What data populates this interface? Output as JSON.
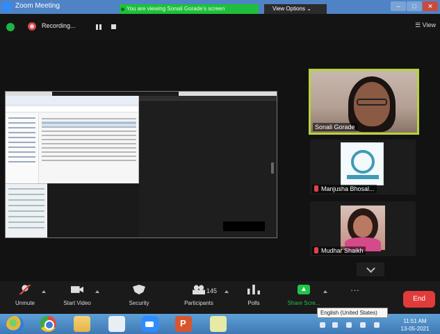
{
  "window": {
    "title": "Zoom Meeting",
    "viewing_banner": "You are viewing Sonali Gorade's screen",
    "view_options": "View Options"
  },
  "recording": {
    "label": "Recording...",
    "view_label": "View"
  },
  "participants": [
    {
      "name": "Sonali Gorade",
      "muted": false,
      "active_speaker": true
    },
    {
      "name": "Manjusha Bhosal...",
      "muted": true
    },
    {
      "name": "Mudhar Shaikh",
      "muted": true
    }
  ],
  "toolbar": {
    "unmute": "Unmute",
    "start_video": "Start Video",
    "security": "Security",
    "participants": "Participants",
    "participants_count": "145",
    "polls": "Polls",
    "share_screen": "Share Scre...",
    "more": "...",
    "end": "End"
  },
  "taskbar": {
    "tooltip": "English (United States)",
    "time": "11:51 AM",
    "date": "13-05-2021"
  },
  "colors": {
    "active_speaker_border": "#b7d33d",
    "share_green": "#22c24b",
    "end_red": "#e23b3b",
    "titlebar_blue": "#4f83c6"
  }
}
